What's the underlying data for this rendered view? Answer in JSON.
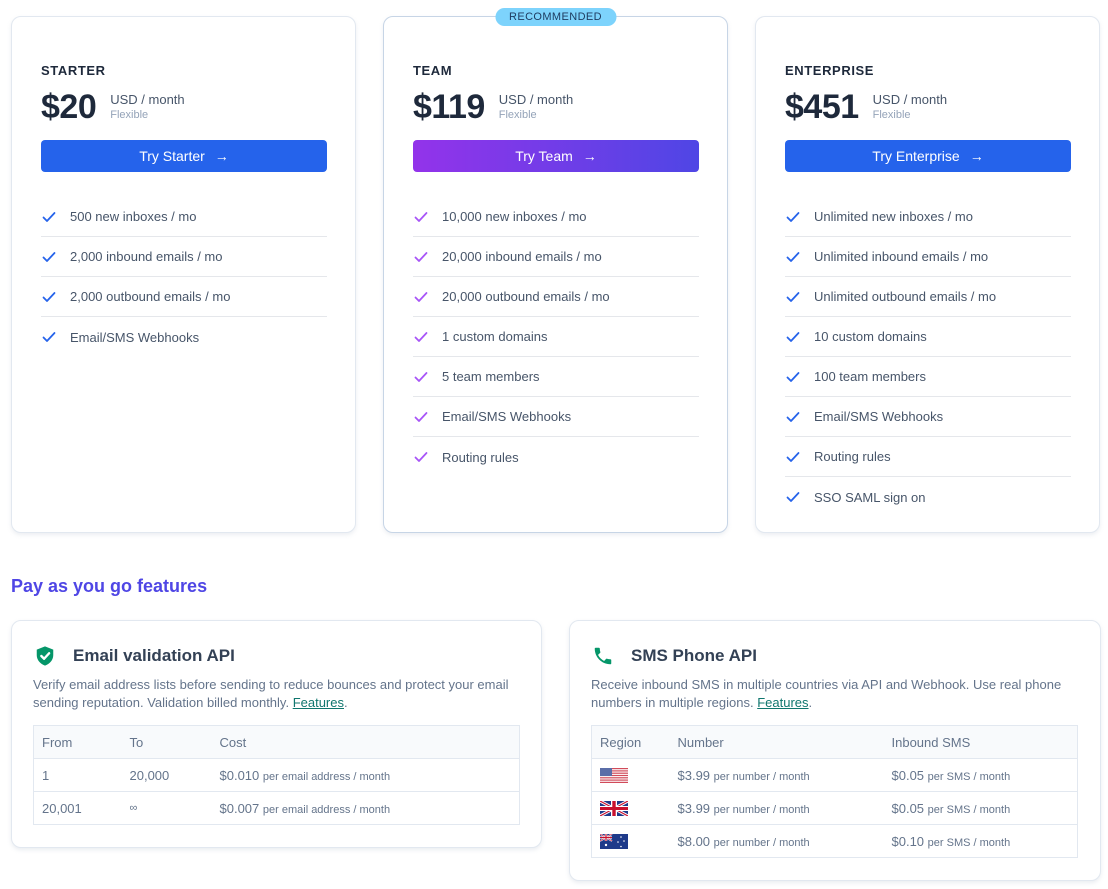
{
  "plans": [
    {
      "name": "STARTER",
      "price": "$20",
      "unit": "USD / month",
      "note": "Flexible",
      "cta": "Try Starter",
      "accent": "#2563eb",
      "features": [
        "500 new inboxes / mo",
        "2,000 inbound emails / mo",
        "2,000 outbound emails / mo",
        "Email/SMS Webhooks"
      ]
    },
    {
      "name": "TEAM",
      "badge": "RECOMMENDED",
      "price": "$119",
      "unit": "USD / month",
      "note": "Flexible",
      "cta": "Try Team",
      "accent": "#9333ea",
      "features": [
        "10,000 new inboxes / mo",
        "20,000 inbound emails / mo",
        "20,000 outbound emails / mo",
        "1 custom domains",
        "5 team members",
        "Email/SMS Webhooks",
        "Routing rules"
      ]
    },
    {
      "name": "ENTERPRISE",
      "price": "$451",
      "unit": "USD / month",
      "note": "Flexible",
      "cta": "Try Enterprise",
      "accent": "#2563eb",
      "features": [
        "Unlimited new inboxes / mo",
        "Unlimited inbound emails / mo",
        "Unlimited outbound emails / mo",
        "10 custom domains",
        "100 team members",
        "Email/SMS Webhooks",
        "Routing rules",
        "SSO SAML sign on"
      ]
    }
  ],
  "cta_arrow": "→",
  "payg": {
    "title": "Pay as you go features",
    "email": {
      "icon": "shield-check-icon",
      "title": "Email validation API",
      "desc": "Verify email address lists before sending to reduce bounces and protect your email sending reputation. Validation billed monthly. ",
      "link": "Features",
      "link_suffix": ".",
      "columns": [
        "From",
        "To",
        "Cost"
      ],
      "rows": [
        {
          "from": "1",
          "to": "20,000",
          "cost": "$0.010",
          "cost_unit": "per email address / month"
        },
        {
          "from": "20,001",
          "to": "∞",
          "cost": "$0.007",
          "cost_unit": "per email address / month"
        }
      ]
    },
    "sms": {
      "icon": "phone-icon",
      "title": "SMS Phone API",
      "desc": "Receive inbound SMS in multiple countries via API and Webhook. Use real phone numbers in multiple regions. ",
      "link": "Features",
      "link_suffix": ".",
      "columns": [
        "Region",
        "Number",
        "Inbound SMS"
      ],
      "rows": [
        {
          "region": "us-flag-icon",
          "number": "$3.99",
          "number_unit": "per number / month",
          "sms": "$0.05",
          "sms_unit": "per SMS / month"
        },
        {
          "region": "uk-flag-icon",
          "number": "$3.99",
          "number_unit": "per number / month",
          "sms": "$0.05",
          "sms_unit": "per SMS / month"
        },
        {
          "region": "au-flag-icon",
          "number": "$8.00",
          "number_unit": "per number / month",
          "sms": "$0.10",
          "sms_unit": "per SMS / month"
        }
      ]
    }
  }
}
